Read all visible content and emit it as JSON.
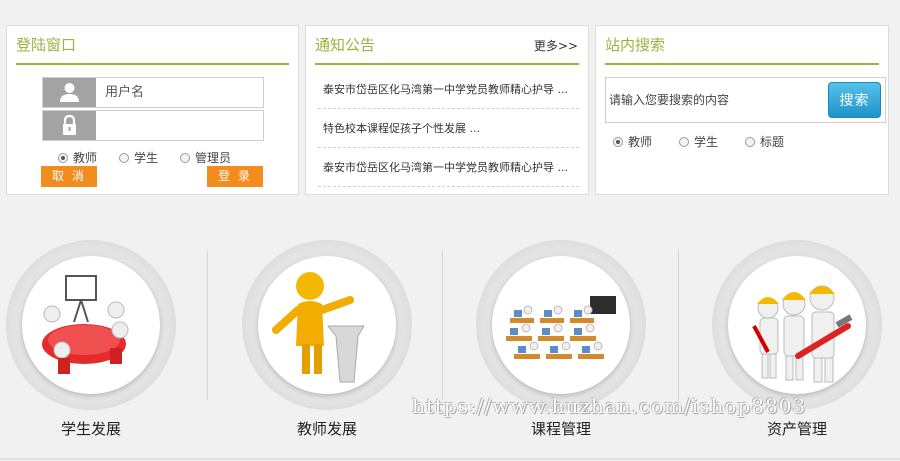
{
  "login": {
    "title": "登陆窗口",
    "username_placeholder": "用户名",
    "password_value": "",
    "roles": [
      "教师",
      "学生",
      "管理员"
    ],
    "selected_role": "教师",
    "cancel_label": "取 消",
    "login_label": "登 录"
  },
  "notice": {
    "title": "通知公告",
    "more_label": "更多>>",
    "items": [
      "泰安市岱岳区化马湾第一中学党员教师精心护导 ...",
      "特色校本课程促孩子个性发展 ...",
      "泰安市岱岳区化马湾第一中学党员教师精心护导 ..."
    ]
  },
  "search": {
    "title": "站内搜索",
    "placeholder": "请输入您要搜索的内容",
    "button_label": "搜索",
    "options": [
      "教师",
      "学生",
      "标题"
    ],
    "selected_option": "教师"
  },
  "features": [
    {
      "label": "学生发展",
      "icon": "students-meeting-icon"
    },
    {
      "label": "教师发展",
      "icon": "teacher-podium-icon"
    },
    {
      "label": "课程管理",
      "icon": "classroom-icon"
    },
    {
      "label": "资产管理",
      "icon": "workers-tools-icon"
    }
  ],
  "watermark": "https://www.huzhan.com/ishop8803",
  "colors": {
    "accent_green": "#9ab43c",
    "button_orange": "#f28c1c",
    "search_blue": "#1e93c9"
  }
}
